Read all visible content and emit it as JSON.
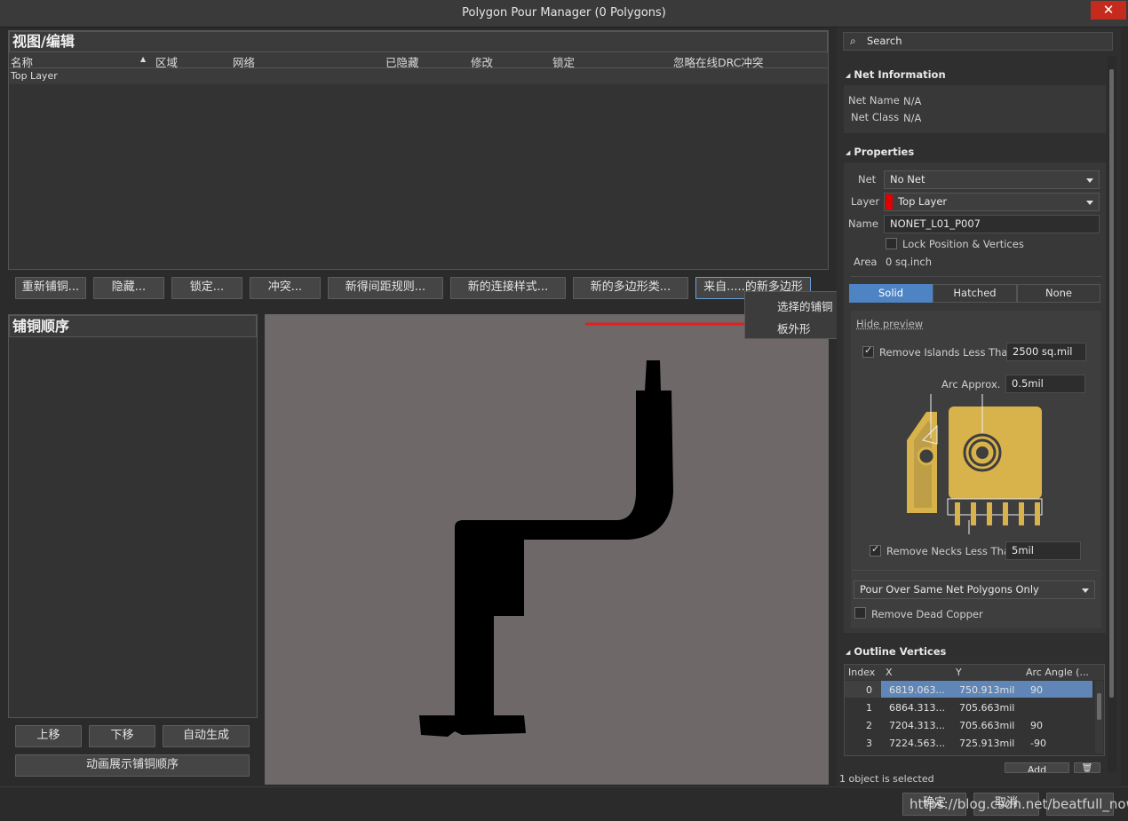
{
  "window": {
    "title": "Polygon Pour Manager (0 Polygons)",
    "close_glyph": "✕"
  },
  "view_edit": {
    "title": "视图/编辑",
    "columns": [
      "名称",
      "区域",
      "网络",
      "已隐藏",
      "修改",
      "锁定",
      "忽略在线DRC冲突"
    ],
    "rows": [
      "Top Layer"
    ]
  },
  "toolbar": {
    "buttons": [
      "重新铺铜...",
      "隐藏...",
      "锁定...",
      "冲突...",
      "新得间距规则...",
      "新的连接样式...",
      "新的多边形类...",
      "来自.....的新多边形"
    ]
  },
  "context_menu": {
    "items": [
      "选择的铺铜",
      "板外形"
    ]
  },
  "pour_order": {
    "title": "铺铜顺序",
    "buttons": {
      "up": "上移",
      "down": "下移",
      "auto": "自动生成",
      "animate": "动画展示铺铜顺序"
    }
  },
  "right_panel": {
    "search_placeholder": "Search",
    "net_info": {
      "title": "Net Information",
      "net_name_label": "Net Name",
      "net_name": "N/A",
      "net_class_label": "Net Class",
      "net_class": "N/A"
    },
    "properties": {
      "title": "Properties",
      "net_label": "Net",
      "net_value": "No Net",
      "layer_label": "Layer",
      "layer_value": "Top Layer",
      "layer_color": "#e00000",
      "name_label": "Name",
      "name_value": "NONET_L01_P007",
      "lock_label": "Lock Position & Vertices",
      "area_label": "Area",
      "area_value": "0 sq.inch",
      "fill_modes": [
        "Solid",
        "Hatched",
        "None"
      ],
      "selected_mode": "Solid",
      "hide_preview": "Hide preview",
      "remove_islands_label": "Remove Islands Less Than",
      "remove_islands_value": "2500 sq.mil",
      "arc_approx_label": "Arc Approx.",
      "arc_approx_value": "0.5mil",
      "remove_necks_label": "Remove Necks Less Than",
      "remove_necks_value": "5mil",
      "pour_over": "Pour Over Same Net Polygons Only",
      "remove_dead_copper": "Remove Dead Copper"
    },
    "outline_vertices": {
      "title": "Outline Vertices",
      "columns": [
        "Index",
        "X",
        "Y",
        "Arc Angle (..."
      ],
      "rows": [
        {
          "index": "0",
          "x": "6819.063...",
          "y": "750.913mil",
          "arc": "90"
        },
        {
          "index": "1",
          "x": "6864.313...",
          "y": "705.663mil",
          "arc": ""
        },
        {
          "index": "2",
          "x": "7204.313...",
          "y": "705.663mil",
          "arc": "90"
        },
        {
          "index": "3",
          "x": "7224.563...",
          "y": "725.913mil",
          "arc": "-90"
        }
      ],
      "add_label": "Add"
    },
    "status": "1 object is selected"
  },
  "footer": {
    "ok": "确定",
    "cancel": "取消",
    "watermark": "https://blog.csdn.net/beatfull_now"
  },
  "colors": {
    "accent": "#4e84c4",
    "copper": "#d8b24a",
    "preview_bg": "#6e6868",
    "arrow": "#e02020"
  }
}
